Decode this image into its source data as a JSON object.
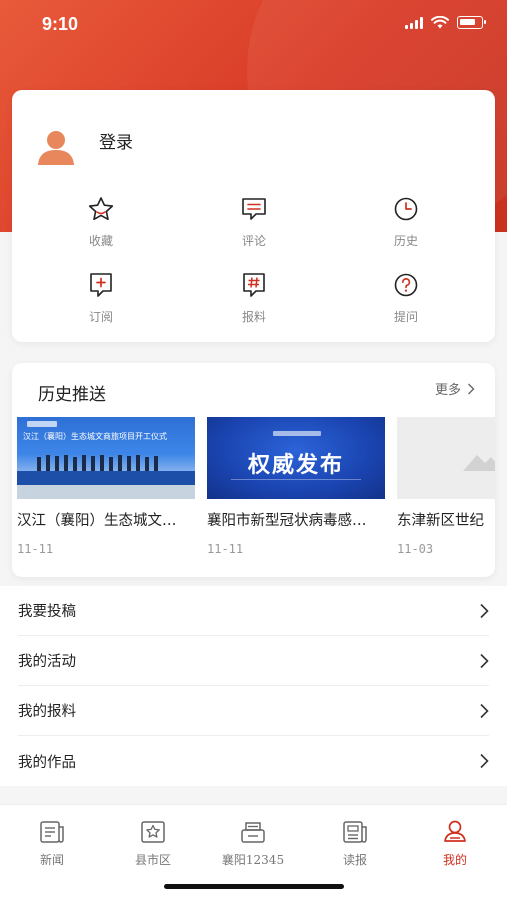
{
  "status": {
    "time": "9:10"
  },
  "profile": {
    "login_label": "登录",
    "actions": [
      {
        "label": "收藏",
        "icon": "star-icon"
      },
      {
        "label": "评论",
        "icon": "comment-icon"
      },
      {
        "label": "历史",
        "icon": "clock-icon"
      },
      {
        "label": "订阅",
        "icon": "subscribe-icon"
      },
      {
        "label": "报料",
        "icon": "hashtag-icon"
      },
      {
        "label": "提问",
        "icon": "question-icon"
      }
    ]
  },
  "history": {
    "title": "历史推送",
    "more_label": "更多",
    "items": [
      {
        "title": "汉江（襄阳）生态城文商旅项目开工仪式",
        "date": "11-11",
        "thumb_text": "汉江（襄阳）生态城文商旅项目开工仪式"
      },
      {
        "title": "襄阳市新型冠状病毒感染的肺炎疫情防控",
        "date": "11-11",
        "thumb_text": "权威发布"
      },
      {
        "title": "东津新区世纪",
        "date": "11-03",
        "thumb_text": ""
      }
    ]
  },
  "menu": {
    "items": [
      {
        "label": "我要投稿"
      },
      {
        "label": "我的活动"
      },
      {
        "label": "我的报料"
      },
      {
        "label": "我的作品"
      }
    ]
  },
  "tabs": [
    {
      "label": "新闻",
      "icon": "news-icon",
      "active": false
    },
    {
      "label": "县市区",
      "icon": "county-icon",
      "active": false
    },
    {
      "label": "襄阳12345",
      "icon": "hotline-icon",
      "active": false
    },
    {
      "label": "读报",
      "icon": "newspaper-icon",
      "active": false
    },
    {
      "label": "我的",
      "icon": "profile-icon",
      "active": true
    }
  ],
  "colors": {
    "accent": "#d0301f",
    "hero": "#e0472e"
  }
}
